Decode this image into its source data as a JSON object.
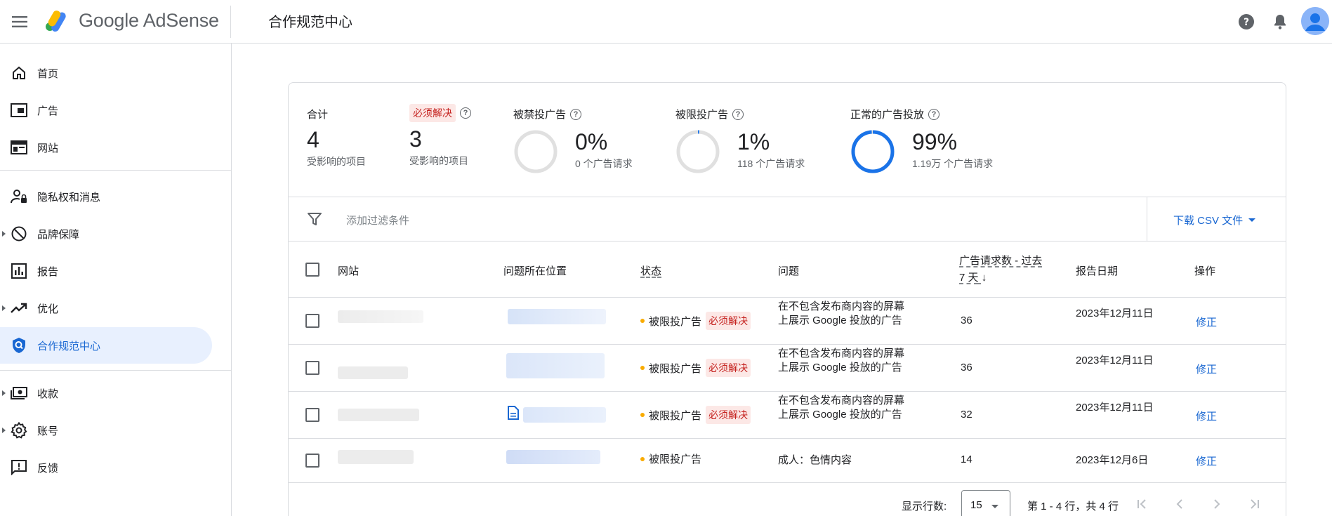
{
  "header": {
    "brand_google": "Google",
    "brand_product": "AdSense",
    "page_title": "合作规范中心"
  },
  "sidebar": {
    "items": [
      {
        "label": "首页",
        "icon": "home-icon"
      },
      {
        "label": "广告",
        "icon": "ads-icon"
      },
      {
        "label": "网站",
        "icon": "sites-icon"
      },
      {
        "label": "隐私权和消息",
        "icon": "privacy-icon"
      },
      {
        "label": "品牌保障",
        "icon": "block-icon"
      },
      {
        "label": "报告",
        "icon": "report-icon"
      },
      {
        "label": "优化",
        "icon": "trending-icon"
      },
      {
        "label": "合作规范中心",
        "icon": "policy-shield-icon"
      },
      {
        "label": "收款",
        "icon": "payments-icon"
      },
      {
        "label": "账号",
        "icon": "gear-icon"
      },
      {
        "label": "反馈",
        "icon": "feedback-icon"
      }
    ]
  },
  "summary": {
    "total": {
      "label": "合计",
      "value": "4",
      "sub": "受影响的项目"
    },
    "must_fix": {
      "label": "必须解决",
      "value": "3",
      "sub": "受影响的项目"
    },
    "banned": {
      "label": "被禁投广告",
      "value": "0%",
      "sub": "0 个广告请求",
      "fraction": 0
    },
    "restricted": {
      "label": "被限投广告",
      "value": "1%",
      "sub": "118 个广告请求",
      "fraction": 0.01
    },
    "normal": {
      "label": "正常的广告投放",
      "value": "99%",
      "sub": "1.19万 个广告请求",
      "fraction": 0.99
    }
  },
  "colors": {
    "accent": "#1a73e8",
    "danger": "#c5221f",
    "warn": "#f9ab00"
  },
  "filter": {
    "placeholder": "添加过滤条件",
    "csv": "下载 CSV 文件"
  },
  "table": {
    "headers": {
      "site": "网站",
      "location": "问题所在位置",
      "status": "状态",
      "issue": "问题",
      "requests": "广告请求数 - 过去 7 天",
      "date": "报告日期",
      "action": "操作"
    },
    "rows": [
      {
        "status": "被限投广告",
        "badge": "必须解决",
        "issue": "在不包含发布商内容的屏幕上展示 Google 投放的广告",
        "requests": "36",
        "date": "2023年12月11日",
        "action": "修正"
      },
      {
        "status": "被限投广告",
        "badge": "必须解决",
        "issue": "在不包含发布商内容的屏幕上展示 Google 投放的广告",
        "requests": "36",
        "date": "2023年12月11日",
        "action": "修正"
      },
      {
        "status": "被限投广告",
        "badge": "必须解决",
        "issue": "在不包含发布商内容的屏幕上展示 Google 投放的广告",
        "requests": "32",
        "date": "2023年12月11日",
        "action": "修正"
      },
      {
        "status": "被限投广告",
        "badge": "",
        "issue": "成人：色情内容",
        "requests": "14",
        "date": "2023年12月6日",
        "action": "修正"
      }
    ]
  },
  "pagination": {
    "rows_label": "显示行数:",
    "rows_value": "15",
    "range": "第 1 - 4 行，共 4 行"
  }
}
